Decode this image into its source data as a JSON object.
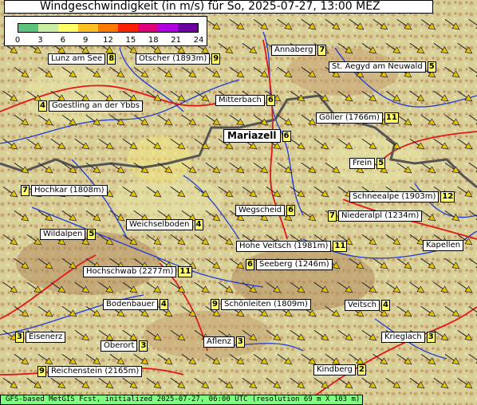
{
  "title": "Windgeschwindigkeit (in m/s) für So, 2025-07-27, 13:00 MEZ",
  "footer": "GFS-based MetGIS Fcst, initialized 2025-07-27, 06:00 UTC  (resolution 69 m X 103 m)",
  "legend": {
    "ticks": [
      "0",
      "3",
      "6",
      "9",
      "12",
      "15",
      "18",
      "21",
      "24"
    ],
    "colors": [
      "#5ec37a",
      "#c8f0a0",
      "#ffff66",
      "#ffc020",
      "#ff7a00",
      "#ff2000",
      "#e0007a",
      "#b000e0",
      "#6a00a0"
    ]
  },
  "arrow_color": "#e6c200",
  "places": [
    {
      "id": "lunz",
      "name": "Lunz am See",
      "value": "8"
    },
    {
      "id": "oetscher",
      "name": "Ötscher (1893m)",
      "value": "9"
    },
    {
      "id": "annaberg",
      "name": "Annaberg",
      "value": "7"
    },
    {
      "id": "aegyd",
      "name": "St. Aegyd am Neuwald",
      "value": "5"
    },
    {
      "id": "goestling",
      "name": "Goestling an der Ybbs",
      "value": "4"
    },
    {
      "id": "mitterbach",
      "name": "Mitterbach",
      "value": "6"
    },
    {
      "id": "goeller",
      "name": "Göller (1766m)",
      "value": "11"
    },
    {
      "id": "mariazell",
      "name": "Mariazell",
      "value": "6"
    },
    {
      "id": "frein",
      "name": "Frein",
      "value": "5"
    },
    {
      "id": "hochkar",
      "name": "Hochkar (1808m)",
      "value": "7"
    },
    {
      "id": "schneealpe",
      "name": "Schneealpe (1903m)",
      "value": "12"
    },
    {
      "id": "wegscheid",
      "name": "Wegscheid",
      "value": "6"
    },
    {
      "id": "niederalpl",
      "name": "Niederalpl (1234m)",
      "value": "7"
    },
    {
      "id": "weichselboden",
      "name": "Weichselboden",
      "value": "4"
    },
    {
      "id": "wildalpen",
      "name": "Wildalpen",
      "value": "5"
    },
    {
      "id": "hoheveitsch",
      "name": "Hohe Veitsch (1981m)",
      "value": "11"
    },
    {
      "id": "kapellen",
      "name": "Kapellen",
      "value": ""
    },
    {
      "id": "seeberg",
      "name": "Seeberg (1246m)",
      "value": "6"
    },
    {
      "id": "hochschwab",
      "name": "Hochschwab (2277m)",
      "value": "11"
    },
    {
      "id": "bodenbauer",
      "name": "Bodenbauer",
      "value": "4"
    },
    {
      "id": "schoenleiten",
      "name": "Schönleiten (1809m)",
      "value": "9"
    },
    {
      "id": "veitsch",
      "name": "Veitsch",
      "value": "4"
    },
    {
      "id": "eisenerz",
      "name": "Eisenerz",
      "value": "3"
    },
    {
      "id": "oberort",
      "name": "Oberort",
      "value": "3"
    },
    {
      "id": "aflenz",
      "name": "Aflenz",
      "value": "3"
    },
    {
      "id": "krieglach",
      "name": "Krieglach",
      "value": "3"
    },
    {
      "id": "reichenstein",
      "name": "Reichenstein (2165m)",
      "value": "9"
    },
    {
      "id": "kindberg",
      "name": "Kindberg",
      "value": "2"
    }
  ]
}
